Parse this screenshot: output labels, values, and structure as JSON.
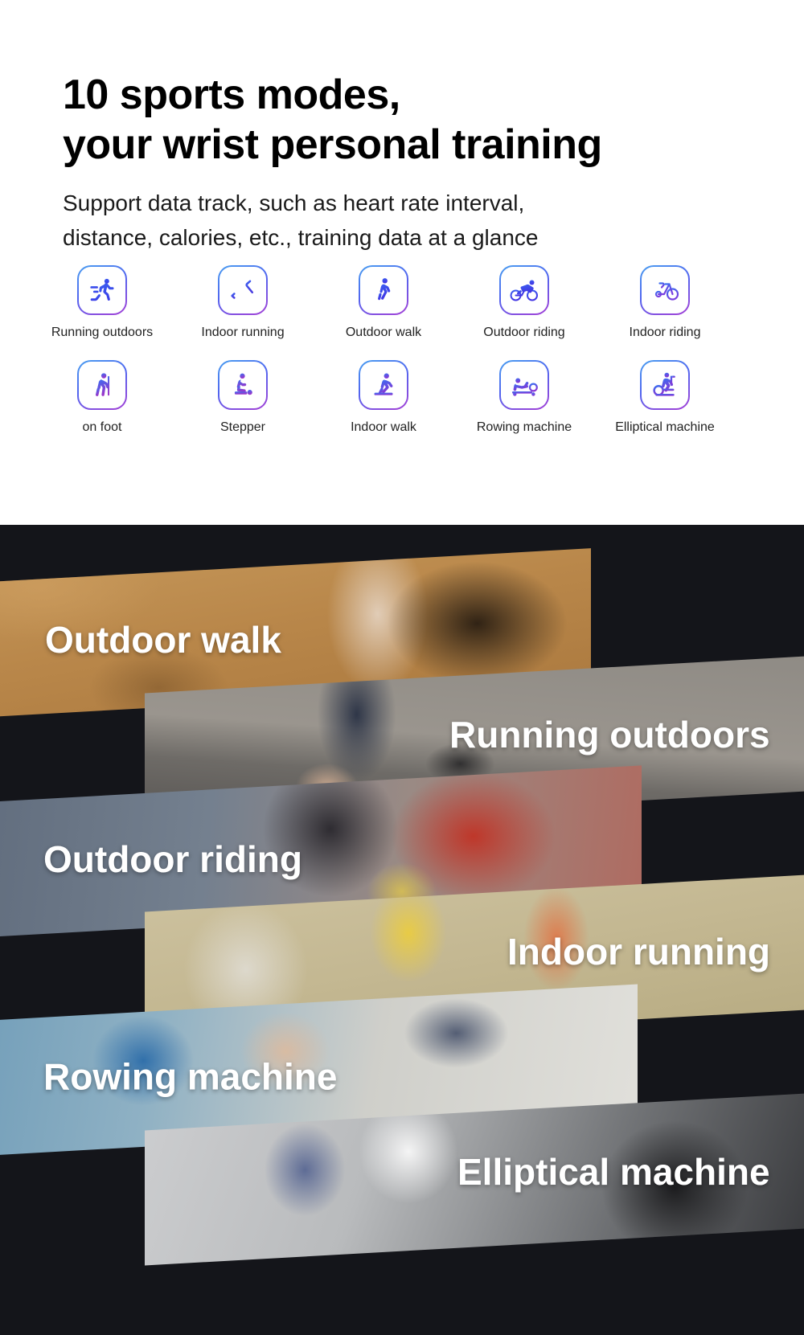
{
  "hero": {
    "title_line1": "10 sports modes,",
    "title_line2": "your wrist personal training",
    "subtitle_line1": "Support data track, such as heart rate interval,",
    "subtitle_line2": "distance, calories, etc., training data at a glance"
  },
  "modes": [
    {
      "label": "Running outdoors",
      "icon": "running-outdoors-icon"
    },
    {
      "label": "Indoor running",
      "icon": "treadmill-icon"
    },
    {
      "label": "Outdoor walk",
      "icon": "walking-icon"
    },
    {
      "label": "Outdoor riding",
      "icon": "cyclist-icon"
    },
    {
      "label": "Indoor riding",
      "icon": "bicycle-icon"
    },
    {
      "label": "on foot",
      "icon": "hiking-icon"
    },
    {
      "label": "Stepper",
      "icon": "stepper-icon"
    },
    {
      "label": "Indoor walk",
      "icon": "indoor-walk-icon"
    },
    {
      "label": "Rowing machine",
      "icon": "rowing-machine-icon"
    },
    {
      "label": "Elliptical machine",
      "icon": "elliptical-machine-icon"
    }
  ],
  "banners": [
    {
      "label": "Outdoor walk",
      "align": "left"
    },
    {
      "label": "Running outdoors",
      "align": "right"
    },
    {
      "label": "Outdoor riding",
      "align": "left"
    },
    {
      "label": "Indoor running",
      "align": "right"
    },
    {
      "label": "Rowing machine",
      "align": "left"
    },
    {
      "label": "Elliptical machine",
      "align": "right"
    }
  ],
  "colors": {
    "dark_background": "#14151a",
    "gradient_start": "#4a9ff0",
    "gradient_mid": "#5166ef",
    "gradient_end": "#a53fd6",
    "text_primary": "#000000",
    "banner_text": "#ffffff"
  }
}
